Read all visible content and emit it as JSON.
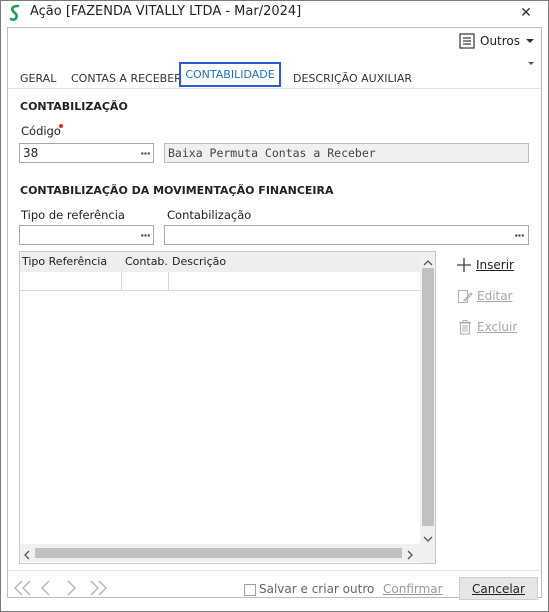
{
  "window": {
    "title": "Ação [FAZENDA VITALLY LTDA - Mar/2024]",
    "close_glyph": "✕"
  },
  "toolbar": {
    "outros_label": "Outros"
  },
  "tabs": [
    {
      "label": "GERAL"
    },
    {
      "label": "CONTAS A RECEBER"
    },
    {
      "label": "CONTABILIDADE",
      "active": true
    },
    {
      "label": "DESCRIÇÃO AUXILIAR"
    }
  ],
  "contabilizacao": {
    "section_title": "CONTABILIZAÇÃO",
    "codigo_label": "Código",
    "codigo_value": "38",
    "descricao_value": "Baixa Permuta Contas a Receber"
  },
  "movimentacao": {
    "section_title": "CONTABILIZAÇÃO DA MOVIMENTAÇÃO FINANCEIRA",
    "tipo_referencia_label": "Tipo de referência",
    "contabilizacao_label": "Contabilização",
    "tipo_referencia_value": "",
    "contabilizacao_value": ""
  },
  "grid": {
    "columns": [
      "Tipo Referência",
      "Contab.",
      "Descrição"
    ],
    "rows": []
  },
  "side_actions": {
    "inserir": "Inserir",
    "editar": "Editar",
    "excluir": "Excluir"
  },
  "footer": {
    "salvar_criar_label": "Salvar e criar outro",
    "confirmar_label": "Confirmar",
    "cancelar_label": "Cancelar"
  },
  "colors": {
    "accent": "#2d5bd7",
    "active_tab_text": "#1f6fc9",
    "required": "#e0282e",
    "logo_green": "#1e9a5a"
  }
}
